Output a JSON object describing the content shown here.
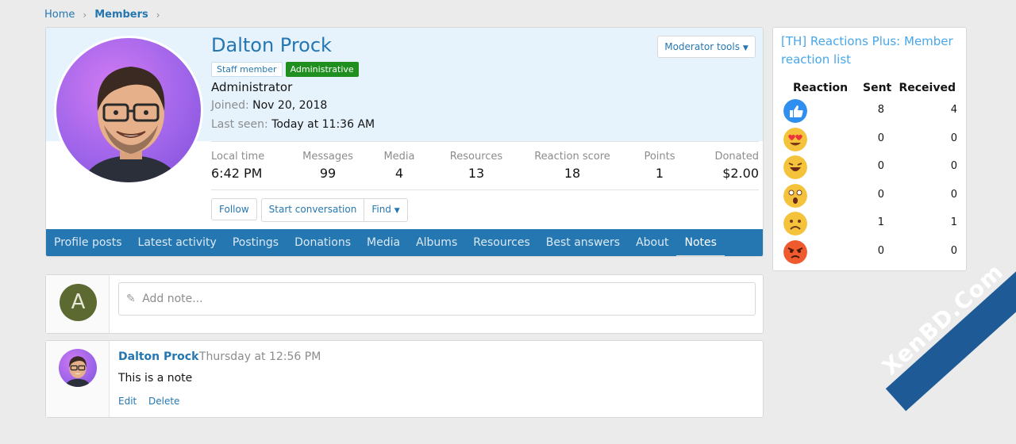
{
  "breadcrumb": {
    "home": "Home",
    "members": "Members"
  },
  "profile": {
    "name": "Dalton Prock",
    "badge_staff": "Staff member",
    "badge_admin": "Administrative",
    "title": "Administrator",
    "joined_label": "Joined:",
    "joined_value": "Nov 20, 2018",
    "last_seen_label": "Last seen:",
    "last_seen_value": "Today at 11:36 AM",
    "moderator_tools": "Moderator tools",
    "stats": {
      "local_time_label": "Local time",
      "local_time_value": "6:42 PM",
      "messages_label": "Messages",
      "messages_value": "99",
      "media_label": "Media",
      "media_value": "4",
      "resources_label": "Resources",
      "resources_value": "13",
      "reaction_label": "Reaction score",
      "reaction_value": "18",
      "points_label": "Points",
      "points_value": "1",
      "donated_label": "Donated",
      "donated_value": "$2.00"
    },
    "buttons": {
      "follow": "Follow",
      "start_conversation": "Start conversation",
      "find": "Find"
    },
    "tabs": [
      "Profile posts",
      "Latest activity",
      "Postings",
      "Donations",
      "Media",
      "Albums",
      "Resources",
      "Best answers",
      "About",
      "Notes"
    ],
    "active_tab": "Notes"
  },
  "add_note": {
    "avatar_letter": "A",
    "placeholder": "Add note..."
  },
  "note": {
    "author": "Dalton Prock",
    "time": "· Thursday at 12:56 PM",
    "body": "This is a note",
    "edit": "Edit",
    "delete": "Delete"
  },
  "sidebar": {
    "title": "[TH] Reactions Plus: Member reaction list",
    "headers": {
      "reaction": "Reaction",
      "sent": "Sent",
      "received": "Received"
    },
    "rows": [
      {
        "icon": "like-icon",
        "sent": "8",
        "received": "4"
      },
      {
        "icon": "love-icon",
        "sent": "0",
        "received": "0"
      },
      {
        "icon": "haha-icon",
        "sent": "0",
        "received": "0"
      },
      {
        "icon": "wow-icon",
        "sent": "0",
        "received": "0"
      },
      {
        "icon": "sad-icon",
        "sent": "1",
        "received": "1"
      },
      {
        "icon": "angry-icon",
        "sent": "0",
        "received": "0"
      }
    ]
  },
  "watermark": "XenBD.Com",
  "colors": {
    "accent": "#2577b1",
    "link": "#47a7eb",
    "admin_badge": "#1f8f1f",
    "banner": "#e6f3fd"
  }
}
